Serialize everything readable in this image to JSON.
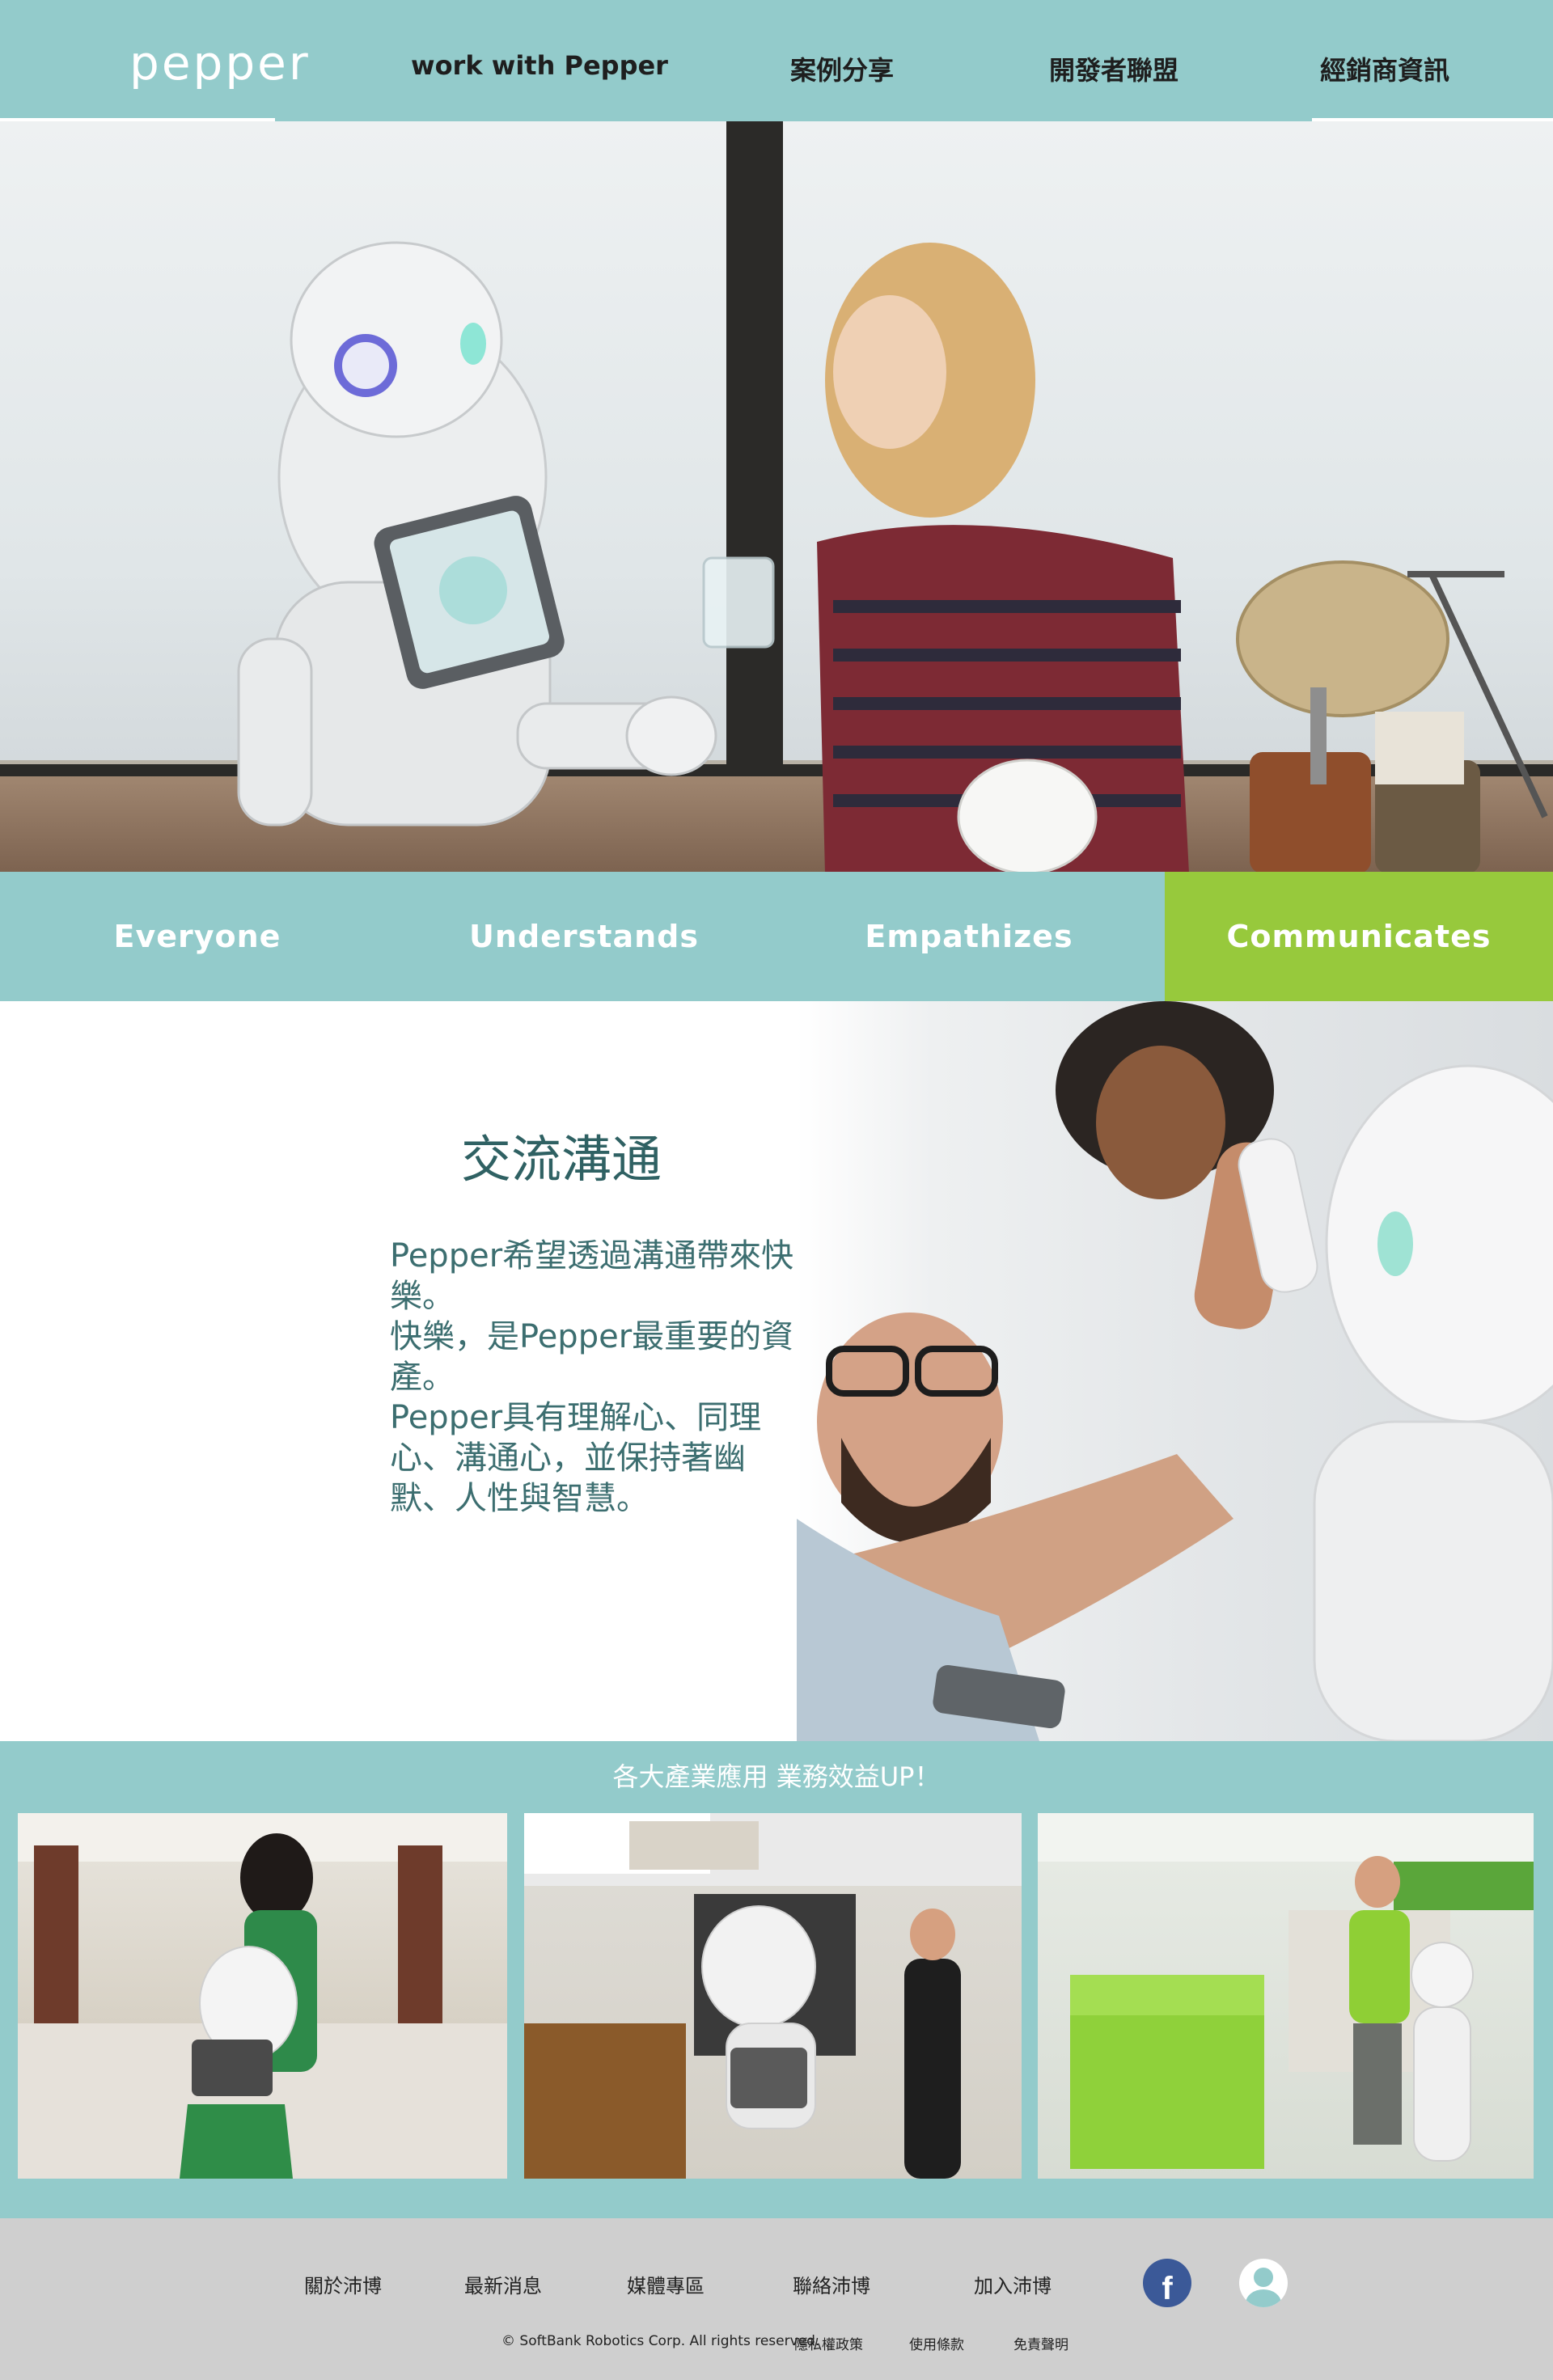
{
  "brand": {
    "logo_text": "pepper"
  },
  "nav": {
    "items": [
      "work with Pepper",
      "案例分享",
      "開發者聯盟",
      "經銷商資訊"
    ]
  },
  "tabs": {
    "items": [
      "Everyone",
      "Understands",
      "Empathizes",
      "Communicates"
    ],
    "active": "Communicates"
  },
  "feature": {
    "title": "交流溝通",
    "lines": [
      "Pepper希望透過溝通帶來快樂。",
      "快樂，是Pepper最重要的資產。",
      "Pepper具有理解心、同理心、溝通心，並保持著幽默、人性與智慧。"
    ]
  },
  "cases": {
    "title": "各大產業應用 業務效益UP！"
  },
  "footer": {
    "links": [
      "關於沛博",
      "最新消息",
      "媒體專區",
      "聯絡沛博",
      "加入沛博"
    ],
    "copyright": "© SoftBank Robotics Corp. All rights reserved.",
    "legal": [
      "隱私權政策",
      "使用條款",
      "免責聲明"
    ],
    "facebook_glyph": "f"
  },
  "colors": {
    "teal": "#93cbcb",
    "active_green": "#97c93c",
    "feature_text": "#3c6e70",
    "footer_bg": "#cfcfcf",
    "facebook_blue": "#3b5998"
  },
  "icons": [
    "facebook-icon",
    "user-account-icon"
  ]
}
